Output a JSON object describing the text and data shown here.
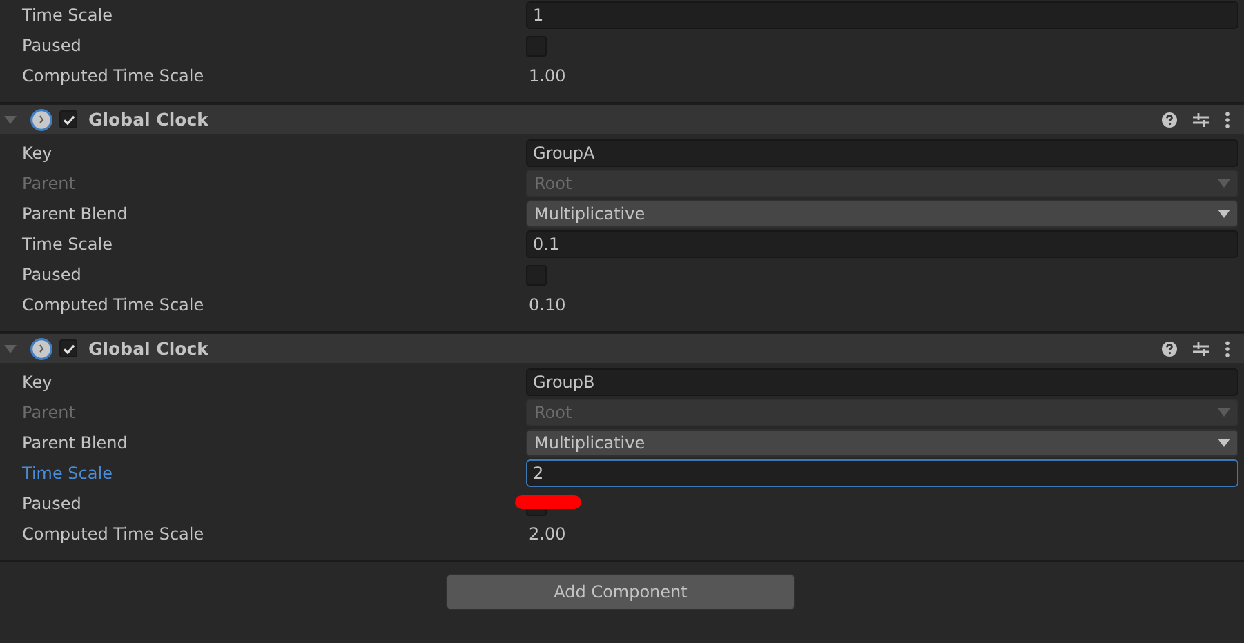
{
  "components": [
    {
      "rows": [
        {
          "label": "Time Scale",
          "kind": "text-field",
          "value": "1",
          "focused": false
        },
        {
          "label": "Paused",
          "kind": "checkbox",
          "checked": false,
          "redacted": false
        },
        {
          "label": "Computed Time Scale",
          "kind": "readout",
          "value": "1.00"
        }
      ]
    },
    {
      "header": {
        "title": "Global Clock",
        "expanded": true,
        "enabled": true
      },
      "rows": [
        {
          "label": "Key",
          "kind": "text-field",
          "value": "GroupA",
          "focused": false
        },
        {
          "label": "Parent",
          "kind": "dropdown",
          "value": "Root",
          "disabled": true
        },
        {
          "label": "Parent Blend",
          "kind": "dropdown",
          "value": "Multiplicative",
          "disabled": false
        },
        {
          "label": "Time Scale",
          "kind": "text-field",
          "value": "0.1",
          "focused": false
        },
        {
          "label": "Paused",
          "kind": "checkbox",
          "checked": false,
          "redacted": false
        },
        {
          "label": "Computed Time Scale",
          "kind": "readout",
          "value": "0.10"
        }
      ]
    },
    {
      "header": {
        "title": "Global Clock",
        "expanded": true,
        "enabled": true
      },
      "rows": [
        {
          "label": "Key",
          "kind": "text-field",
          "value": "GroupB",
          "focused": false
        },
        {
          "label": "Parent",
          "kind": "dropdown",
          "value": "Root",
          "disabled": true
        },
        {
          "label": "Parent Blend",
          "kind": "dropdown",
          "value": "Multiplicative",
          "disabled": false
        },
        {
          "label": "Time Scale",
          "kind": "text-field",
          "value": "2",
          "focused": true
        },
        {
          "label": "Paused",
          "kind": "checkbox",
          "checked": false,
          "redacted": true
        },
        {
          "label": "Computed Time Scale",
          "kind": "readout",
          "value": "2.00"
        }
      ]
    }
  ],
  "add_button": "Add Component"
}
